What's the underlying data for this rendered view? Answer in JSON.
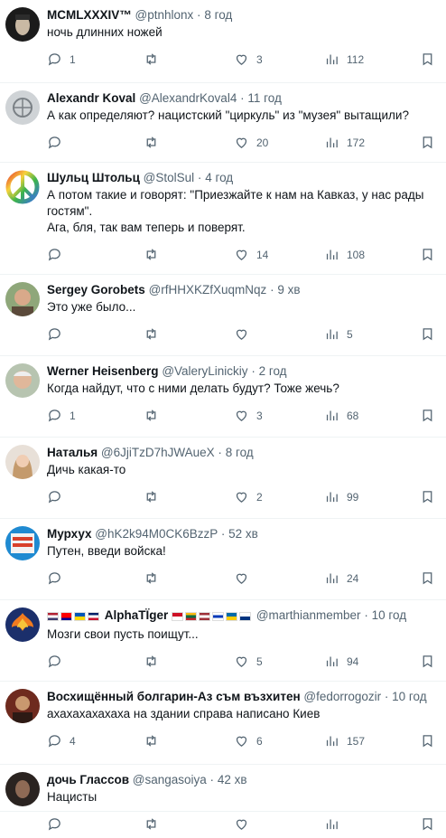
{
  "tweets": [
    {
      "name": "MCMLXXXIV™",
      "handle": "@ptnhlonx",
      "time": "8 год",
      "lines": [
        "ночь длинних ножей"
      ],
      "replies": "1",
      "retweets": "",
      "likes": "3",
      "views": "112",
      "avatar": "dark",
      "height": 92
    },
    {
      "name": "Alexandr Koval",
      "handle": "@AlexandrKoval4",
      "time": "11 год",
      "lines": [
        "А как определяют? нацистский \"циркуль\" из \"музея\" вытащили?"
      ],
      "replies": "",
      "retweets": "",
      "likes": "20",
      "views": "172",
      "avatar": "grey",
      "height": 88
    },
    {
      "name": "Шульц Штольц",
      "handle": "@StolSul",
      "time": "4 год",
      "lines": [
        "А потом такие и говорят: \"Приезжайте к нам на Кавказ, у нас рады",
        "гостям\".",
        "Ага, бля, так вам теперь и поверят."
      ],
      "replies": "",
      "retweets": "",
      "likes": "14",
      "views": "108",
      "avatar": "peace",
      "height": 124
    },
    {
      "name": "Sergey Gorobets",
      "handle": "@rfHHXKZfXuqmNqz",
      "time": "9 хв",
      "lines": [
        "Это уже было..."
      ],
      "replies": "",
      "retweets": "",
      "likes": "",
      "views": "5",
      "avatar": "face1",
      "height": 90
    },
    {
      "name": "Werner Heisenberg",
      "handle": "@ValeryLinickiy",
      "time": "2 год",
      "lines": [
        "Когда найдут, что с ними делать будут? Тоже жечь?"
      ],
      "replies": "1",
      "retweets": "",
      "likes": "3",
      "views": "68",
      "avatar": "face2",
      "height": 90
    },
    {
      "name": "Наталья",
      "handle": "@6JjiTzD7hJWAueX",
      "time": "8 год",
      "lines": [
        "Дичь какая-то"
      ],
      "replies": "",
      "retweets": "",
      "likes": "2",
      "views": "99",
      "avatar": "woman",
      "height": 90
    },
    {
      "name": "Мурхух",
      "handle": "@hK2k94M0CK6BzzP",
      "time": "52 хв",
      "lines": [
        "Путен, введи войска!"
      ],
      "replies": "",
      "retweets": "",
      "likes": "",
      "views": "24",
      "avatar": "poster",
      "height": 90
    },
    {
      "name": "AlphaTÏger",
      "handle": "@marthianmember",
      "time": "10 год",
      "lines": [
        "Мозги свои пусть поищут..."
      ],
      "replies": "",
      "retweets": "",
      "likes": "5",
      "views": "94",
      "avatar": "phoenix",
      "height": 90,
      "flagged": true
    },
    {
      "name": "Восхищённый болгарин-Аз съм възхитен",
      "handle": "@fedorrogozir",
      "time": "10 год",
      "lines": [
        "ахахахахахаха на здании справа написано Киев"
      ],
      "replies": "4",
      "retweets": "",
      "likes": "6",
      "views": "157",
      "avatar": "man",
      "height": 92
    },
    {
      "name": "дочь Глассов",
      "handle": "@sangasoiya",
      "time": "42 хв",
      "lines": [
        "Нацисты"
      ],
      "replies": "",
      "retweets": "",
      "likes": "",
      "views": "",
      "avatar": "darkface",
      "height": 52
    }
  ],
  "separator": "·",
  "flags_before": [
    "us",
    "tw",
    "ua",
    "gb"
  ],
  "flags_after": [
    "id",
    "lt",
    "lv",
    "il",
    "se",
    "fi"
  ],
  "colors": {
    "text": "#0f1419",
    "muted": "#536471",
    "divider": "#eff3f4"
  }
}
